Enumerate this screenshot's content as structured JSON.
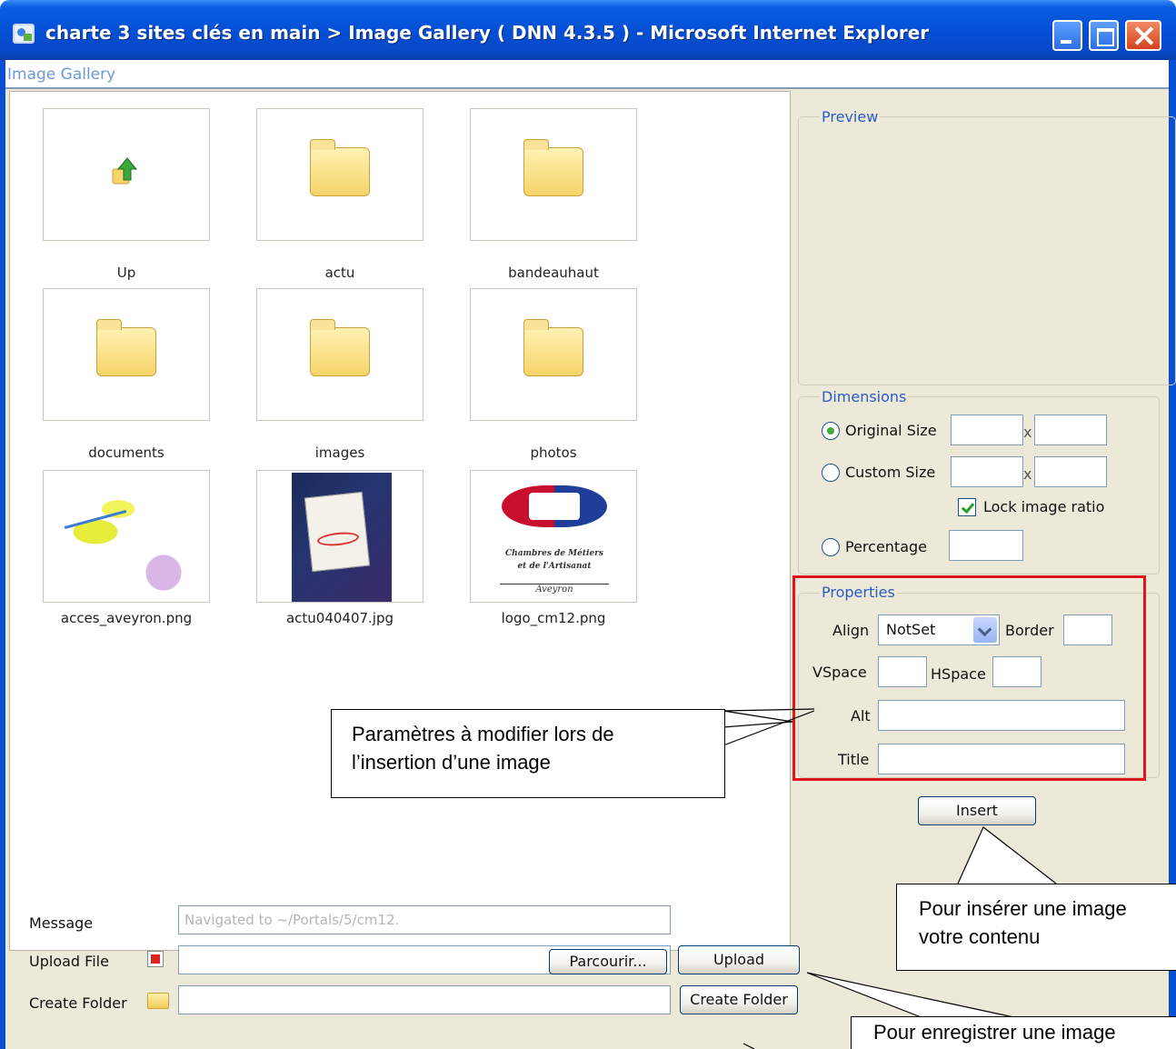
{
  "window": {
    "title": "charte 3 sites clés en main > Image Gallery ( DNN 4.3.5 ) - Microsoft Internet Explorer"
  },
  "gallery": {
    "header": "Image Gallery",
    "items": [
      {
        "label": "Up",
        "kind": "up"
      },
      {
        "label": "actu",
        "kind": "folder"
      },
      {
        "label": "bandeauhaut",
        "kind": "folder"
      },
      {
        "label": "documents",
        "kind": "folder"
      },
      {
        "label": "images",
        "kind": "folder"
      },
      {
        "label": "photos",
        "kind": "folder"
      },
      {
        "label": "acces_aveyron.png",
        "kind": "image"
      },
      {
        "label": "actu040407.jpg",
        "kind": "image"
      },
      {
        "label": "logo_cm12.png",
        "kind": "image"
      }
    ],
    "logo": {
      "line1": "Chambres de Métiers",
      "line2": "et de l'Artisanat",
      "line3": "Aveyron"
    }
  },
  "preview": {
    "legend": "Preview"
  },
  "dimensions": {
    "legend": "Dimensions",
    "original_size": "Original Size",
    "custom_size": "Custom Size",
    "x_sep": "x",
    "lock_ratio": "Lock image ratio",
    "percentage": "Percentage",
    "selected": "original_size",
    "lock_checked": true
  },
  "properties": {
    "legend": "Properties",
    "align_label": "Align",
    "align_value": "NotSet",
    "border_label": "Border",
    "vspace_label": "VSpace",
    "hspace_label": "HSpace",
    "alt_label": "Alt",
    "title_label": "Title"
  },
  "insert_button": "Insert",
  "bottom": {
    "message_label": "Message",
    "message_value": "Navigated to ~/Portals/5/cm12.",
    "upload_label": "Upload File",
    "browse_button": "Parcourir...",
    "upload_button": "Upload",
    "create_folder_label": "Create Folder",
    "create_folder_button": "Create Folder"
  },
  "callouts": {
    "params_line1": "Paramètres à modifier lors de",
    "params_line2": "l’insertion d’une image",
    "insert_line1": "Pour insérer une image",
    "insert_line2": "votre contenu",
    "save_line1": "Pour enregistrer une image"
  },
  "colors": {
    "titlebar": "#0550d6",
    "panel_bg": "#ece9d8",
    "legend_text": "#2a5cc8",
    "highlight": "#e0141c"
  }
}
